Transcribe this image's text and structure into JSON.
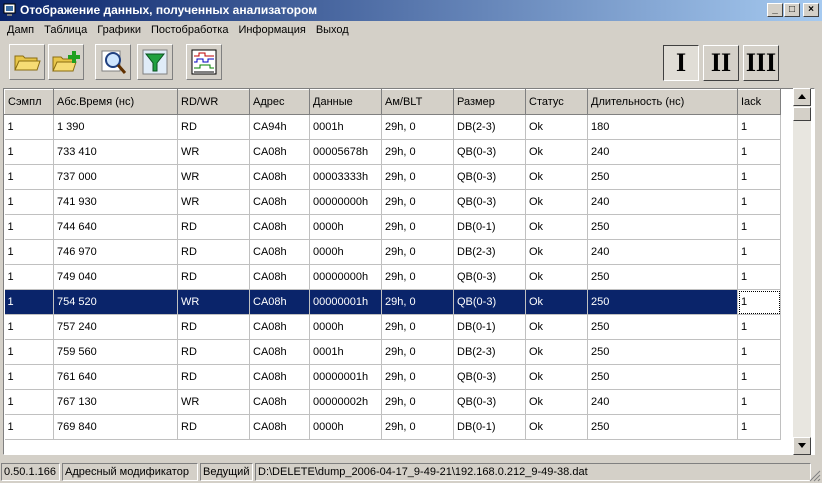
{
  "window": {
    "title": "Отображение данных, полученных анализатором",
    "controls": {
      "minimize": "_",
      "maximize": "□",
      "close": "×"
    }
  },
  "menu": [
    "Дамп",
    "Таблица",
    "Графики",
    "Постобработка",
    "Информация",
    "Выход"
  ],
  "toolbar": {
    "buttons": [
      "open-folder-icon",
      "add-folder-icon",
      "search-icon",
      "filter-icon",
      "timing-diagram-icon"
    ],
    "views": [
      {
        "label": "I",
        "active": true
      },
      {
        "label": "II",
        "active": false
      },
      {
        "label": "III",
        "active": false
      }
    ]
  },
  "table": {
    "columns": [
      "Сэмпл",
      "Абс.Время (нс)",
      "RD/WR",
      "Адрес",
      "Данные",
      "Ам/BLT",
      "Размер",
      "Статус",
      "Длительность (нс)",
      "Iack"
    ],
    "rows": [
      [
        "1",
        "1 390",
        "RD",
        "CA94h",
        "0001h",
        "29h, 0",
        "DB(2-3)",
        "Ok",
        "180",
        "1"
      ],
      [
        "1",
        "733 410",
        "WR",
        "CA08h",
        "00005678h",
        "29h, 0",
        "QB(0-3)",
        "Ok",
        "240",
        "1"
      ],
      [
        "1",
        "737 000",
        "WR",
        "CA08h",
        "00003333h",
        "29h, 0",
        "QB(0-3)",
        "Ok",
        "250",
        "1"
      ],
      [
        "1",
        "741 930",
        "WR",
        "CA08h",
        "00000000h",
        "29h, 0",
        "QB(0-3)",
        "Ok",
        "240",
        "1"
      ],
      [
        "1",
        "744 640",
        "RD",
        "CA08h",
        "0000h",
        "29h, 0",
        "DB(0-1)",
        "Ok",
        "250",
        "1"
      ],
      [
        "1",
        "746 970",
        "RD",
        "CA08h",
        "0000h",
        "29h, 0",
        "DB(2-3)",
        "Ok",
        "240",
        "1"
      ],
      [
        "1",
        "749 040",
        "RD",
        "CA08h",
        "00000000h",
        "29h, 0",
        "QB(0-3)",
        "Ok",
        "250",
        "1"
      ],
      [
        "1",
        "754 520",
        "WR",
        "CA08h",
        "00000001h",
        "29h, 0",
        "QB(0-3)",
        "Ok",
        "250",
        "1"
      ],
      [
        "1",
        "757 240",
        "RD",
        "CA08h",
        "0000h",
        "29h, 0",
        "DB(0-1)",
        "Ok",
        "250",
        "1"
      ],
      [
        "1",
        "759 560",
        "RD",
        "CA08h",
        "0001h",
        "29h, 0",
        "DB(2-3)",
        "Ok",
        "250",
        "1"
      ],
      [
        "1",
        "761 640",
        "RD",
        "CA08h",
        "00000001h",
        "29h, 0",
        "QB(0-3)",
        "Ok",
        "250",
        "1"
      ],
      [
        "1",
        "767 130",
        "WR",
        "CA08h",
        "00000002h",
        "29h, 0",
        "QB(0-3)",
        "Ok",
        "240",
        "1"
      ],
      [
        "1",
        "769 840",
        "RD",
        "CA08h",
        "0000h",
        "29h, 0",
        "DB(0-1)",
        "Ok",
        "250",
        "1"
      ]
    ],
    "selected_row": 7
  },
  "status": {
    "version": "0.50.1.166",
    "modifier": "Адресный модификатор",
    "role": "Ведущий",
    "file": "D:\\DELETE\\dump_2006-04-17_9-49-21\\192.168.0.212_9-49-38.dat"
  },
  "colors": {
    "selection": "#0a246a",
    "face": "#d4d0c8"
  }
}
